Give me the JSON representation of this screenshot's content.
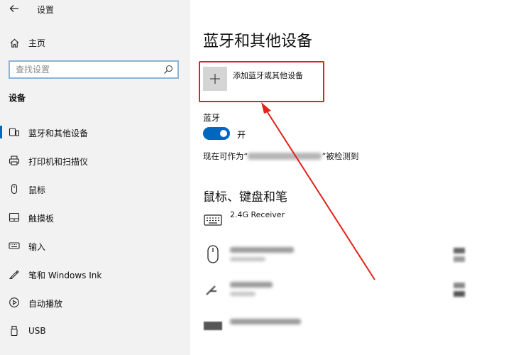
{
  "window": {
    "title": "设置",
    "back_icon": "back-arrow-icon"
  },
  "sidebar": {
    "home_label": "主页",
    "search_placeholder": "查找设置",
    "section_heading": "设备",
    "items": [
      {
        "label": "蓝牙和其他设备",
        "icon": "bluetooth-devices-icon",
        "active": true
      },
      {
        "label": "打印机和扫描仪",
        "icon": "printer-icon",
        "active": false
      },
      {
        "label": "鼠标",
        "icon": "mouse-icon",
        "active": false
      },
      {
        "label": "触摸板",
        "icon": "touchpad-icon",
        "active": false
      },
      {
        "label": "输入",
        "icon": "keyboard-icon",
        "active": false
      },
      {
        "label": "笔和 Windows Ink",
        "icon": "pen-icon",
        "active": false
      },
      {
        "label": "自动播放",
        "icon": "autoplay-icon",
        "active": false
      },
      {
        "label": "USB",
        "icon": "usb-icon",
        "active": false
      }
    ]
  },
  "main": {
    "title": "蓝牙和其他设备",
    "add_device_label": "添加蓝牙或其他设备",
    "bluetooth_label": "蓝牙",
    "bluetooth_state": "开",
    "discoverable_prefix": "现在可作为“",
    "discoverable_suffix": "”被检测到",
    "section_mouse_keyboard_pen": "鼠标、键盘和笔",
    "devices": [
      {
        "name": "2.4G Receiver",
        "icon": "keyboard-device-icon"
      }
    ]
  },
  "colors": {
    "accent": "#0067c0",
    "annotation": "#e0241b",
    "sidebar_bg": "#f2f2f2"
  }
}
